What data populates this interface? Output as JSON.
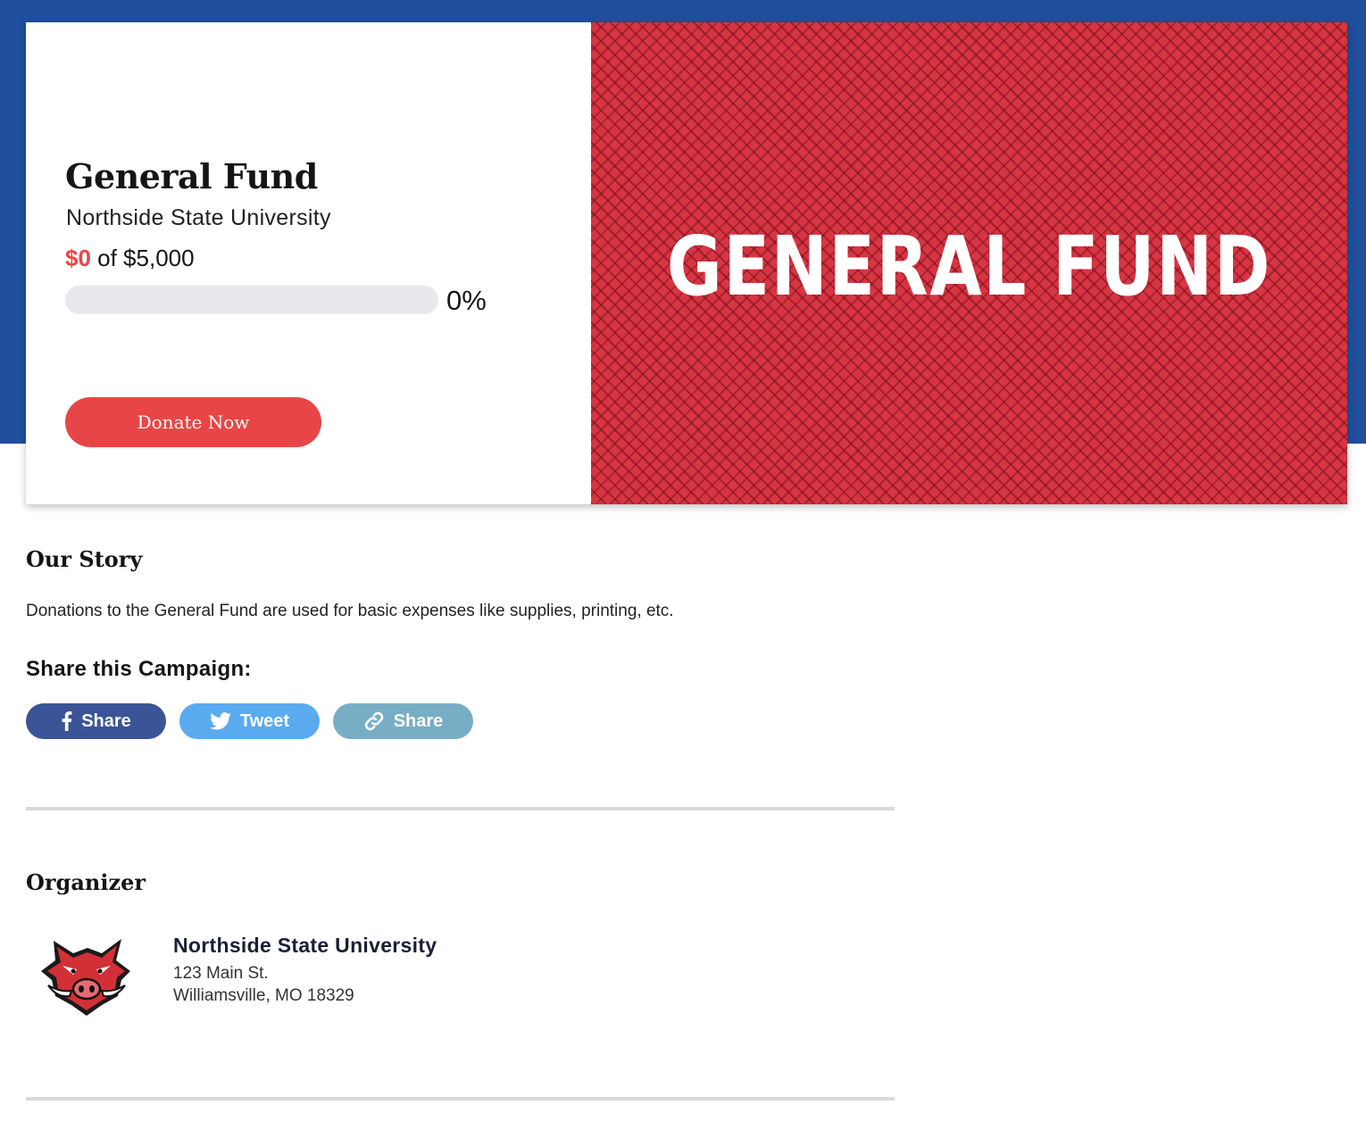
{
  "campaign": {
    "title": "General Fund",
    "organization": "Northside State University",
    "raised": "$0",
    "goal_text": " of $5,000",
    "progress_percent_label": "0%",
    "progress_fraction": 0,
    "donate_label": "Donate Now",
    "banner_text": "GENERAL FUND"
  },
  "story": {
    "heading": "Our Story",
    "text": "Donations to the General Fund are used for basic expenses like supplies, printing, etc."
  },
  "share": {
    "heading": "Share this Campaign:",
    "buttons": [
      {
        "label": "Share",
        "icon": "facebook-icon",
        "color": "#3b5497"
      },
      {
        "label": "Tweet",
        "icon": "twitter-icon",
        "color": "#5aaaf0"
      },
      {
        "label": "Share",
        "icon": "link-icon",
        "color": "#77aec6"
      }
    ]
  },
  "organizer": {
    "heading": "Organizer",
    "name": "Northside State University",
    "address_line1": "123 Main St.",
    "address_line2": "Williamsville, MO 18329",
    "logo_icon": "boar-mascot-logo"
  },
  "colors": {
    "brand_blue": "#1f4f9c",
    "accent_red": "#e84646"
  }
}
